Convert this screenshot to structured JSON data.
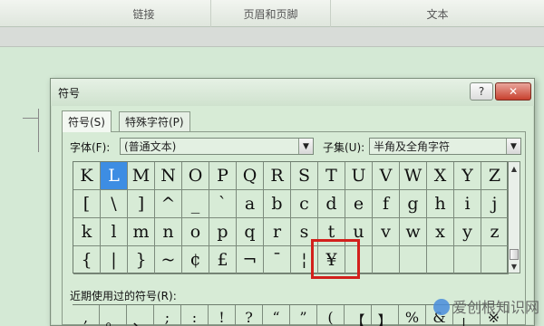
{
  "ribbon": {
    "groups": [
      "链接",
      "页眉和页脚",
      "文本"
    ]
  },
  "dialog": {
    "title": "符号",
    "help_label": "?",
    "close_label": "✕",
    "tabs": [
      {
        "label": "符号(S)"
      },
      {
        "label": "特殊字符(P)"
      }
    ],
    "font_label": "字体(F):",
    "font_value": "(普通文本)",
    "subset_label": "子集(U):",
    "subset_value": "半角及全角字符",
    "grid_rows": [
      [
        "K",
        "L",
        "M",
        "N",
        "O",
        "P",
        "Q",
        "R",
        "S",
        "T",
        "U",
        "V",
        "W",
        "X",
        "Y",
        "Z"
      ],
      [
        "[",
        "\\",
        "]",
        "^",
        "_",
        "`",
        "a",
        "b",
        "c",
        "d",
        "e",
        "f",
        "g",
        "h",
        "i",
        "j"
      ],
      [
        "k",
        "l",
        "m",
        "n",
        "o",
        "p",
        "q",
        "r",
        "s",
        "t",
        "u",
        "v",
        "w",
        "x",
        "y",
        "z"
      ],
      [
        "{",
        "|",
        "}",
        "~",
        "¢",
        "£",
        "¬",
        "¯",
        "¦",
        "¥",
        "",
        "",
        "",
        "",
        "",
        ""
      ]
    ],
    "selected_symbol": "L",
    "highlighted_symbol": "¥",
    "recent_label": "近期使用过的符号(R):",
    "recent_symbols": [
      ",",
      "。",
      "、",
      ";",
      ":",
      "!",
      "?",
      "“",
      "”",
      "(",
      "【",
      "】",
      "%",
      "&",
      "」",
      "※"
    ]
  },
  "watermark": "爱创根知识网",
  "colors": {
    "window_bg": "#d4e9d5",
    "selected_cell": "#3d8de3",
    "highlight_border": "#d2201c"
  }
}
